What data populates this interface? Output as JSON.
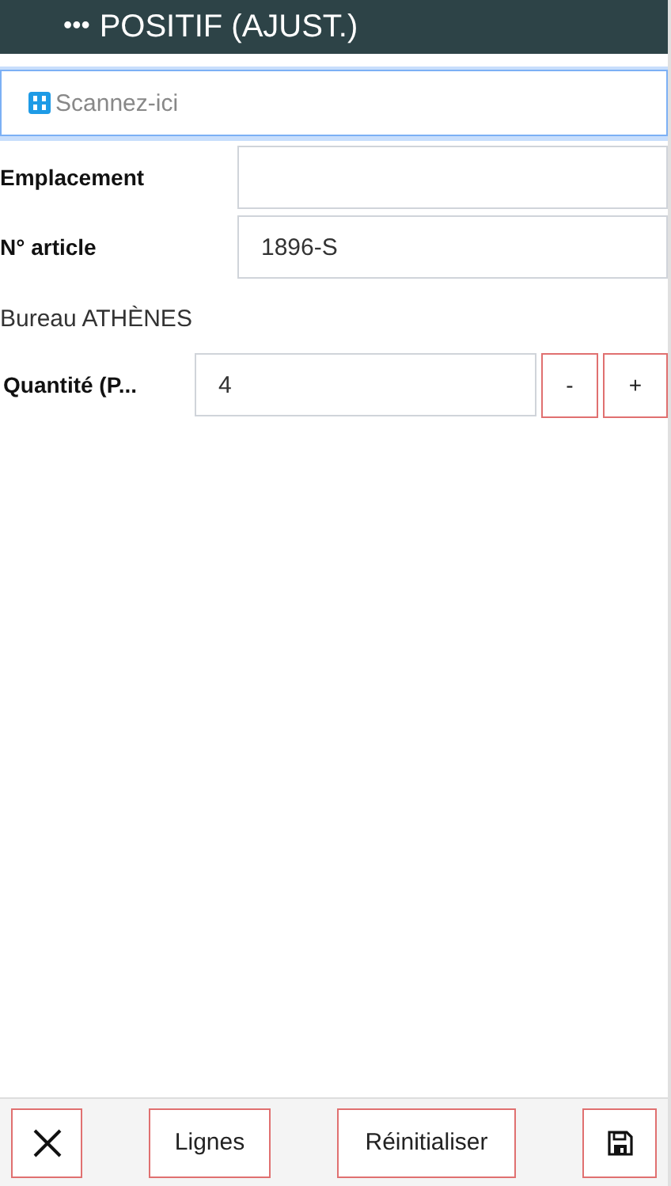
{
  "header": {
    "menu": "•••",
    "title": "POSITIF (AJUST.)"
  },
  "scan": {
    "placeholder": "Scannez-ici"
  },
  "fields": [
    {
      "label": "Emplacement"
    },
    {
      "label": "N° article",
      "value": "1896-S"
    }
  ],
  "location": "Bureau ATHÈNES",
  "quantity": {
    "label": "Quantité (P...",
    "value": "4",
    "minus": "-",
    "plus": "+"
  },
  "footer": {
    "lines": "Lignes",
    "reset": "Réinitialiser"
  }
}
